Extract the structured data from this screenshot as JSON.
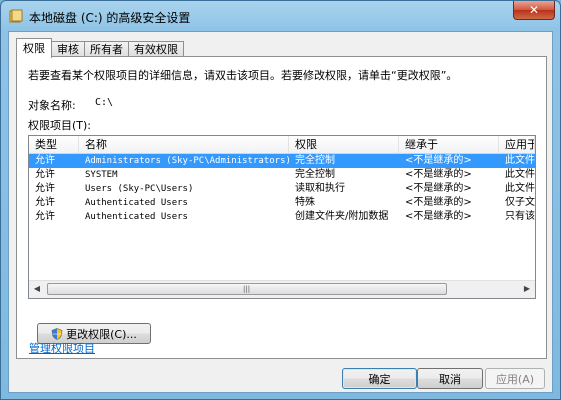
{
  "window": {
    "title": "本地磁盘 (C:) 的高级安全设置",
    "close": "✕"
  },
  "tabs": [
    {
      "label": "权限"
    },
    {
      "label": "审核"
    },
    {
      "label": "所有者"
    },
    {
      "label": "有效权限"
    }
  ],
  "info_text": "若要查看某个权限项目的详细信息，请双击该项目。若要修改权限，请单击“更改权限”。",
  "object": {
    "label": "对象名称:",
    "value": "C:\\"
  },
  "entries_label": "权限项目(T):",
  "columns": [
    "类型",
    "名称",
    "权限",
    "继承于",
    "应用于"
  ],
  "rows": [
    {
      "type": "允许",
      "name": "Administrators (Sky-PC\\Administrators)",
      "permission": "完全控制",
      "inherited": "<不是继承的>",
      "apply": "此文件",
      "selected": true
    },
    {
      "type": "允许",
      "name": "SYSTEM",
      "permission": "完全控制",
      "inherited": "<不是继承的>",
      "apply": "此文件"
    },
    {
      "type": "允许",
      "name": "Users (Sky-PC\\Users)",
      "permission": "读取和执行",
      "inherited": "<不是继承的>",
      "apply": "此文件"
    },
    {
      "type": "允许",
      "name": "Authenticated Users",
      "permission": "特殊",
      "inherited": "<不是继承的>",
      "apply": "仅子文"
    },
    {
      "type": "允许",
      "name": "Authenticated Users",
      "permission": "创建文件夹/附加数据",
      "inherited": "<不是继承的>",
      "apply": "只有该"
    }
  ],
  "scrollbar": {
    "left": "◀",
    "right": "▶",
    "grip": "|||"
  },
  "buttons": {
    "change": "更改权限(C)...",
    "ok": "确定",
    "cancel": "取消",
    "apply": "应用(A)"
  },
  "manage_link": "管理权限项目",
  "colors": {
    "selection": "#3399ff",
    "link": "#0066cc"
  }
}
